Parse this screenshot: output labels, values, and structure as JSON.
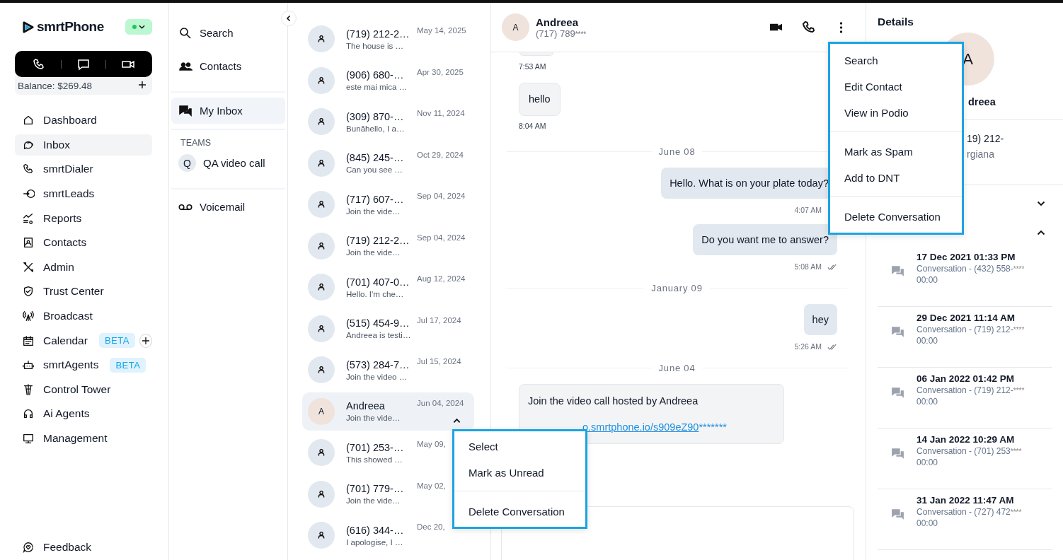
{
  "sidebar": {
    "logo": "smrtPhone",
    "status": {
      "online": true
    },
    "balance": "Balance: $269.48",
    "items": [
      {
        "label": "Dashboard",
        "selected": false
      },
      {
        "label": "Inbox",
        "selected": true
      },
      {
        "label": "smrtDialer",
        "selected": false
      },
      {
        "label": "smrtLeads",
        "selected": false
      },
      {
        "label": "Reports",
        "selected": false
      },
      {
        "label": "Contacts",
        "selected": false
      },
      {
        "label": "Admin",
        "selected": false
      },
      {
        "label": "Trust Center",
        "selected": false
      },
      {
        "label": "Broadcast",
        "selected": false
      },
      {
        "label": "Calendar",
        "selected": false,
        "badge": "BETA",
        "addable": true
      },
      {
        "label": "smrtAgents",
        "selected": false,
        "badge": "BETA"
      },
      {
        "label": "Control Tower",
        "selected": false
      },
      {
        "label": "Ai Agents",
        "selected": false
      },
      {
        "label": "Management",
        "selected": false
      }
    ],
    "footer": "Feedback"
  },
  "inbox_nav": {
    "items": [
      {
        "label": "Search",
        "selected": false
      },
      {
        "label": "Contacts",
        "selected": false
      },
      {
        "label": "My Inbox",
        "selected": true
      }
    ],
    "teams_heading": "TEAMS",
    "teams": [
      {
        "initial": "Q",
        "label": "QA video call"
      }
    ],
    "voicemail": "Voicemail"
  },
  "conversations": [
    {
      "name": "(719) 212-2…",
      "preview": "The house is …",
      "date": "May 14, 2025",
      "selected": false
    },
    {
      "name": "(906) 680-…",
      "preview": "este mai mica …",
      "date": "Apr 30, 2025",
      "selected": false
    },
    {
      "name": "(309) 870-…",
      "preview": "Bunăhello, I a…",
      "date": "Nov 11, 2024",
      "selected": false
    },
    {
      "name": "(845) 245-…",
      "preview": "Can you see …",
      "date": "Oct 29, 2024",
      "selected": false
    },
    {
      "name": "(717) 607-…",
      "preview": "Join the vide…",
      "date": "Sep 04, 2024",
      "selected": false
    },
    {
      "name": "(719) 212-2…",
      "preview": "Join the vide…",
      "date": "Sep 04, 2024",
      "selected": false
    },
    {
      "name": "(701) 407-0…",
      "preview": "Hello. I'm che…",
      "date": "Aug 12, 2024",
      "selected": false
    },
    {
      "name": "(515) 454-9…",
      "preview": "Andreea is testi…",
      "date": "Jul 17, 2024",
      "selected": false
    },
    {
      "name": "(573) 284-7…",
      "preview": "Join the video …",
      "date": "Jul 15, 2024",
      "selected": false
    },
    {
      "name": "Andreea",
      "initial": "A",
      "preview": "Join the vide…",
      "date": "Jun 04, 2024",
      "selected": true
    },
    {
      "name": "(701) 253-…",
      "preview": "This showed …",
      "date": "May 09,",
      "selected": false
    },
    {
      "name": "(701) 779-…",
      "preview": "Join the vide…",
      "date": "May 02,",
      "selected": false
    },
    {
      "name": "(616) 344-…",
      "preview": "I apologise, I …",
      "date": "Dec 20,",
      "selected": false
    }
  ],
  "conversation_menu": [
    [
      "Select",
      "Mark as Unread"
    ],
    [
      "Delete Conversation"
    ]
  ],
  "chat": {
    "initial": "A",
    "name": "Andreea",
    "phone": "(717) 789",
    "masked": "****",
    "messages": [
      {
        "kind": "time",
        "text": "7:53 AM"
      },
      {
        "kind": "in",
        "text": "hello",
        "time": "8:04 AM"
      },
      {
        "kind": "date",
        "text": "June 08"
      },
      {
        "kind": "out",
        "text": "Hello. What is on your plate today?",
        "time": "4:07 AM"
      },
      {
        "kind": "out",
        "text": "Do you want me to answer?",
        "time": "5:08 AM",
        "read": true
      },
      {
        "kind": "date",
        "text": "January 09"
      },
      {
        "kind": "out",
        "text": "hey",
        "time": "5:26 AM",
        "read": true
      },
      {
        "kind": "date",
        "text": "June 04"
      },
      {
        "kind": "link",
        "text": "Join the video call hosted by Andreea",
        "link": "o.smrtphone.io/s909eZ90",
        "masked": "*******"
      }
    ]
  },
  "contact_menu": [
    [
      "Search",
      "Edit Contact",
      "View in Podio"
    ],
    [
      "Mark as Spam",
      "Add to DNT"
    ],
    [
      "Delete Conversation"
    ]
  ],
  "details": {
    "title": "Details",
    "initial": "A",
    "name": "dreea",
    "phone": "19) 212-",
    "owner": "rgiana",
    "sections": [
      {
        "expanded": false
      },
      {
        "expanded": true
      }
    ],
    "communications": [
      {
        "title": "17 Dec 2021 01:33 PM",
        "subtitle": "Conversation - (432) 558-",
        "masked": "****",
        "duration": "00:00"
      },
      {
        "title": "29 Dec 2021 11:14 AM",
        "subtitle": "Conversation - (719) 212-",
        "masked": "****",
        "duration": "00:00"
      },
      {
        "title": "06 Jan 2022 01:42 PM",
        "subtitle": "Conversation - (719) 212-",
        "masked": "****",
        "duration": "00:00"
      },
      {
        "title": "14 Jan 2022 10:29 AM",
        "subtitle": "Conversation - (701) 253",
        "masked": "****",
        "duration": "00:00"
      },
      {
        "title": "31 Jan 2022 11:47 AM",
        "subtitle": "Conversation - (727) 472",
        "masked": "****",
        "duration": "00:00"
      }
    ]
  }
}
